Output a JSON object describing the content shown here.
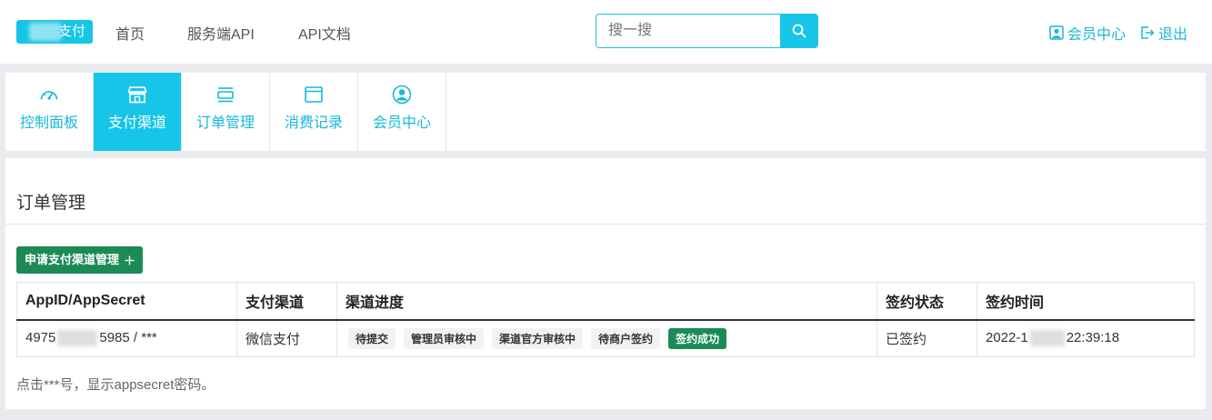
{
  "header": {
    "logo_text": "支付",
    "nav": [
      "首页",
      "服务端API",
      "API文档"
    ],
    "search_placeholder": "搜一搜",
    "member_center": "会员中心",
    "logout": "退出"
  },
  "tabs": [
    {
      "label": "控制面板",
      "icon": "dashboard-icon",
      "active": false
    },
    {
      "label": "支付渠道",
      "icon": "store-icon",
      "active": true
    },
    {
      "label": "订单管理",
      "icon": "order-icon",
      "active": false
    },
    {
      "label": "消费记录",
      "icon": "browser-window-icon",
      "active": false
    },
    {
      "label": "会员中心",
      "icon": "user-circle-icon",
      "active": false
    }
  ],
  "main": {
    "title": "订单管理",
    "apply_button": "申请支付渠道管理",
    "table": {
      "headers": [
        "AppID/AppSecret",
        "支付渠道",
        "渠道进度",
        "签约状态",
        "签约时间"
      ],
      "row": {
        "appid_prefix": "4975",
        "appid_suffix": "5985",
        "secret_sep": " / ***",
        "channel": "微信支付",
        "progress": [
          "待提交",
          "管理员审核中",
          "渠道官方审核中",
          "待商户签约"
        ],
        "progress_done": "签约成功",
        "status": "已签约",
        "time_prefix": "2022-1",
        "time_suffix": "22:39:18"
      }
    },
    "footnote": "点击***号，显示appsecret密码。"
  },
  "colors": {
    "accent": "#17c5e8",
    "success": "#1c8a55",
    "background": "#e9ebee"
  }
}
